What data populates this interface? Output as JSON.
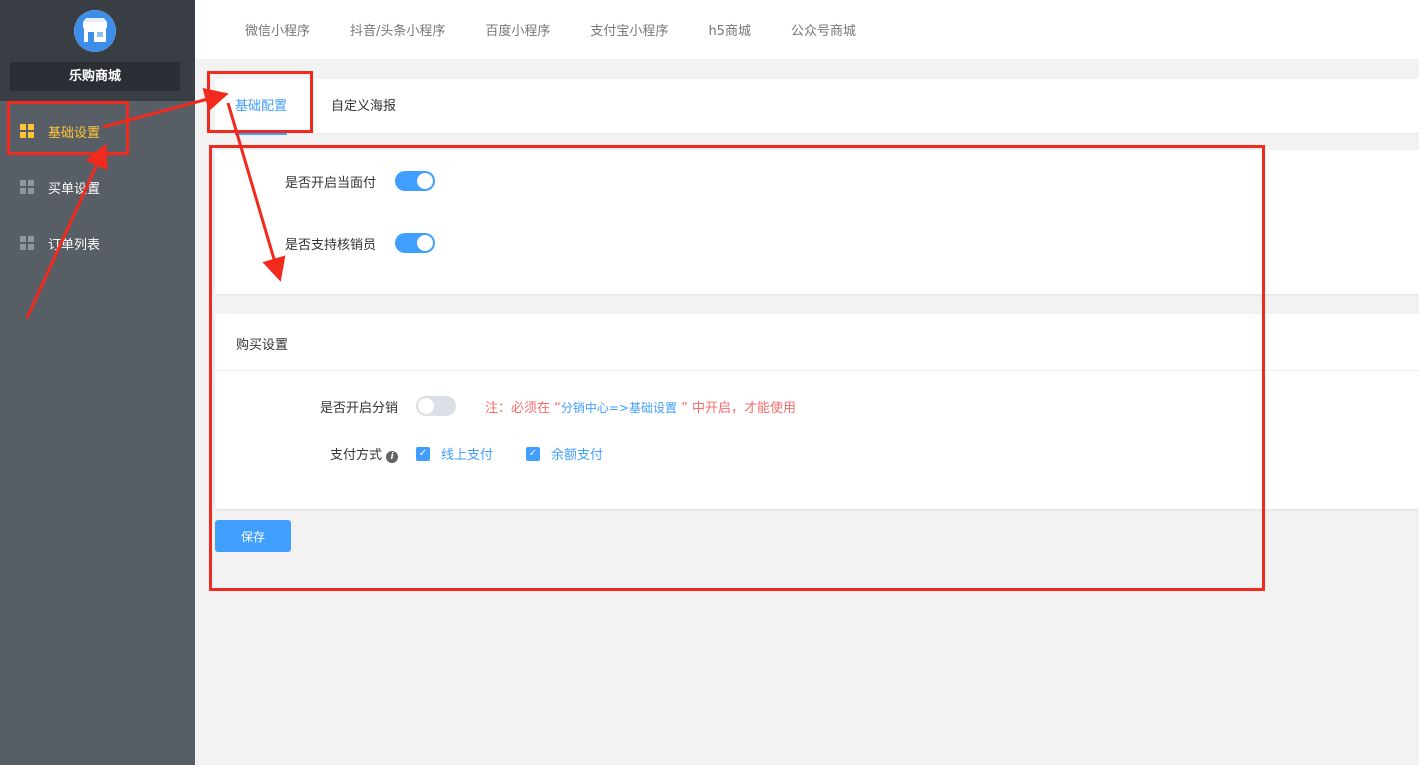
{
  "sidebar": {
    "shop_name": "乐购商城",
    "items": [
      {
        "label": "基础设置",
        "icon": "grid-icon",
        "active": true
      },
      {
        "label": "买单设置",
        "icon": "grid-icon",
        "active": false
      },
      {
        "label": "订单列表",
        "icon": "grid-icon",
        "active": false
      }
    ]
  },
  "topnav": {
    "items": [
      "微信小程序",
      "抖音/头条小程序",
      "百度小程序",
      "支付宝小程序",
      "h5商城",
      "公众号商城"
    ]
  },
  "tabs": [
    {
      "label": "基础配置",
      "active": true
    },
    {
      "label": "自定义海报",
      "active": false
    }
  ],
  "basic": {
    "face_pay_label": "是否开启当面付",
    "face_pay_on": true,
    "verifier_label": "是否支持核销员",
    "verifier_on": true
  },
  "purchase": {
    "title": "购买设置",
    "distribution_label": "是否开启分销",
    "distribution_on": false,
    "note_prefix": "注：必须在 “",
    "note_link": "分销中心=>基础设置",
    "note_suffix": " ” 中开启，才能使用",
    "pay_method_label": "支付方式",
    "pay_options": [
      {
        "label": "线上支付",
        "checked": true
      },
      {
        "label": "余额支付",
        "checked": true
      }
    ]
  },
  "save_label": "保存",
  "colors": {
    "primary": "#409eff",
    "sidebar_bg": "#575e66",
    "sidebar_top_bg": "#393d44",
    "active_menu": "#ffc536",
    "annotation": "#f2291d",
    "warning_text": "#f56c6c"
  }
}
